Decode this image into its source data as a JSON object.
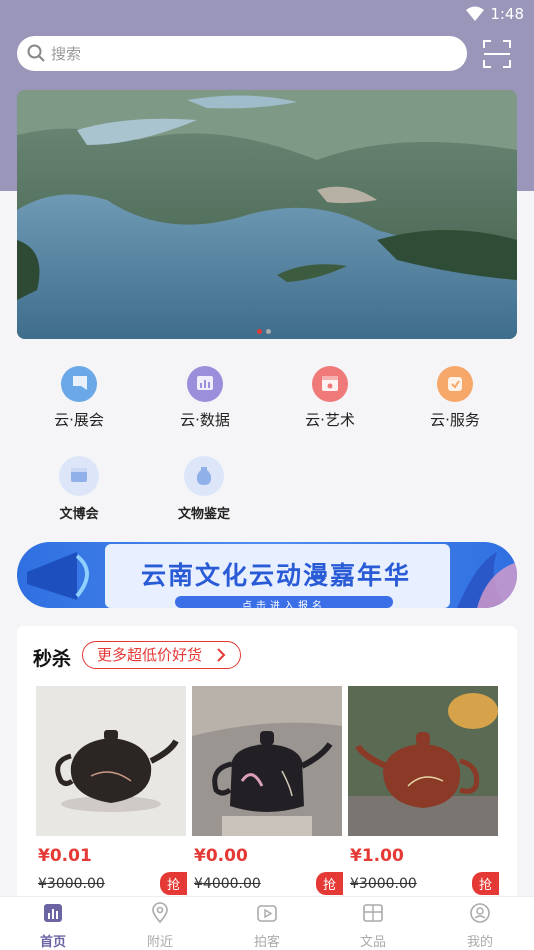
{
  "status_bar": {
    "time": "1:48"
  },
  "search": {
    "placeholder": "搜索"
  },
  "banner": {
    "active_slide": 1,
    "slide_count": 2
  },
  "quick_links": [
    {
      "label": "云·展会",
      "icon": "exhibition-icon",
      "color": "#6aa8e8"
    },
    {
      "label": "云·数据",
      "icon": "data-chart-icon",
      "color": "#9b8fdc"
    },
    {
      "label": "云·艺术",
      "icon": "art-gallery-icon",
      "color": "#f07a7a"
    },
    {
      "label": "云·服务",
      "icon": "service-icon",
      "color": "#f5a86a"
    },
    {
      "label": "文博会",
      "icon": "expo-icon",
      "color": "#8fb0e8"
    },
    {
      "label": "文物鉴定",
      "icon": "vase-icon",
      "color": "#8fb0e8"
    }
  ],
  "promo": {
    "title": "云南文化云动漫嘉年华",
    "subtitle": "点击进入报名"
  },
  "flash_sale": {
    "title": "秒杀",
    "more_label": "更多超低价好货",
    "grab_label": "抢",
    "products": [
      {
        "price": "¥0.01",
        "original_price": "¥3000.00"
      },
      {
        "price": "¥0.00",
        "original_price": "¥4000.00"
      },
      {
        "price": "¥1.00",
        "original_price": "¥3000.00"
      }
    ]
  },
  "tabs": [
    {
      "label": "首页",
      "icon": "home-chart-icon",
      "active": true
    },
    {
      "label": "附近",
      "icon": "location-icon",
      "active": false
    },
    {
      "label": "拍客",
      "icon": "video-play-icon",
      "active": false
    },
    {
      "label": "文品",
      "icon": "shop-icon",
      "active": false
    },
    {
      "label": "我的",
      "icon": "profile-icon",
      "active": false
    }
  ],
  "colors": {
    "header": "#9a96b9",
    "accent": "#e53935",
    "tab_active": "#6b65a3"
  }
}
